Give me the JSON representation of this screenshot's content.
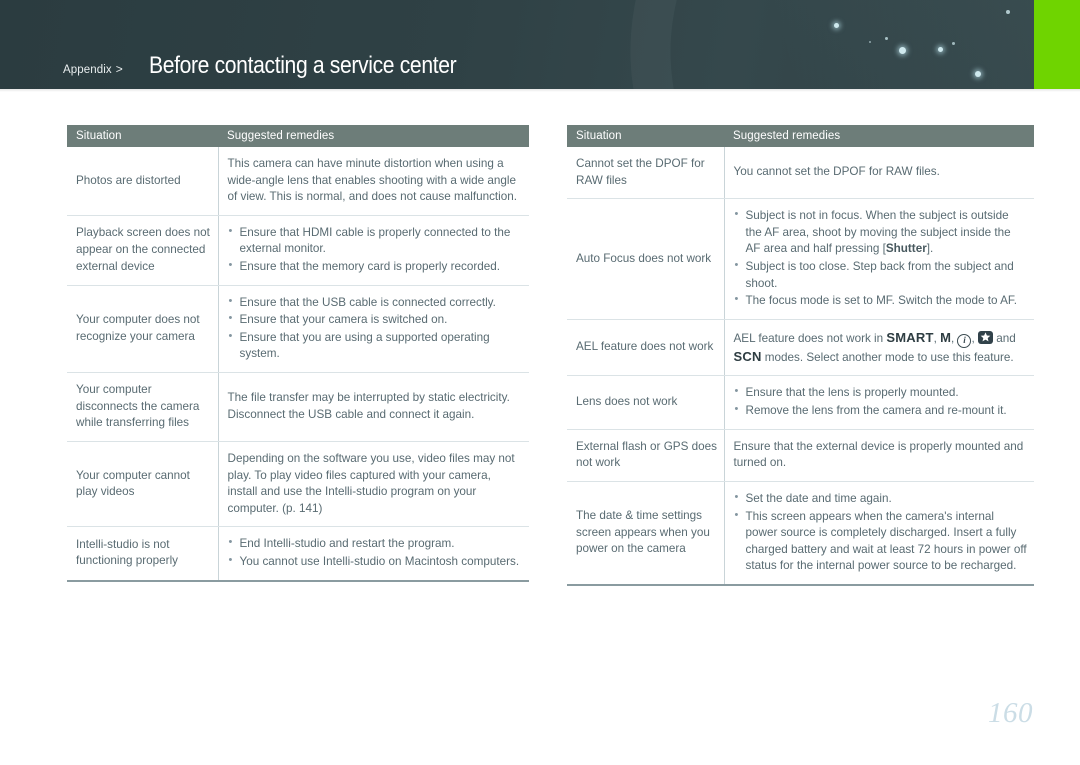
{
  "header": {
    "breadcrumb": "Appendix",
    "breadcrumb_separator": ">",
    "title": "Before contacting a service center",
    "accent_color": "#6fd400",
    "band_color": "#2f4044"
  },
  "tables": {
    "column_headers": {
      "situation": "Situation",
      "remedies": "Suggested remedies"
    },
    "left": [
      {
        "situation": "Photos are distorted",
        "type": "paragraph",
        "text": "This camera can have minute distortion when using a wide-angle lens that enables shooting with a wide angle of view. This is normal, and does not cause malfunction."
      },
      {
        "situation": "Playback screen does not appear on the connected external device",
        "type": "bullets",
        "items": [
          "Ensure that HDMI cable is properly connected to the external monitor.",
          "Ensure that the memory card is properly recorded."
        ]
      },
      {
        "situation": "Your computer does not recognize your camera",
        "type": "bullets",
        "items": [
          "Ensure that the USB cable is connected correctly.",
          "Ensure that your camera is switched on.",
          "Ensure that you are using a supported operating system."
        ]
      },
      {
        "situation": "Your computer disconnects the camera while transferring files",
        "type": "paragraph",
        "text": "The file transfer may be interrupted by static electricity. Disconnect the USB cable and connect it again."
      },
      {
        "situation": "Your computer cannot play videos",
        "type": "paragraph",
        "text": "Depending on the software you use, video files may not play. To play video files captured with your camera, install and use the Intelli-studio program on your computer. (p. 141)"
      },
      {
        "situation": "Intelli-studio is not functioning properly",
        "type": "bullets",
        "items": [
          "End Intelli-studio and restart the program.",
          "You cannot use Intelli-studio on Macintosh computers."
        ]
      }
    ],
    "right": [
      {
        "situation": "Cannot set the DPOF for RAW files",
        "type": "paragraph",
        "text": "You cannot set the DPOF for RAW files."
      },
      {
        "situation": "Auto Focus does not work",
        "type": "bullets-rich",
        "items": [
          {
            "before": "Subject is not in focus. When the subject is outside the AF area, shoot by moving the subject inside the AF area and half pressing [",
            "bold": "Shutter",
            "after": "]."
          },
          {
            "before": "Subject is too close. Step back from the subject and shoot.",
            "bold": "",
            "after": ""
          },
          {
            "before": "The focus mode is set to MF. Switch the mode to AF.",
            "bold": "",
            "after": ""
          }
        ]
      },
      {
        "situation": "AEL feature does not work",
        "type": "modes",
        "text_1": "AEL feature does not work in ",
        "mode_smart": "SMART",
        "sep_1": ", ",
        "mode_m": "M",
        "sep_2": ", ",
        "mode_info": "i",
        "sep_3": ", ",
        "mode_star": "star-badge",
        "text_2": " and ",
        "mode_scn": "SCN",
        "text_3": " modes. Select another mode to use this feature."
      },
      {
        "situation": "Lens does not work",
        "type": "bullets",
        "items": [
          "Ensure that the lens is properly mounted.",
          "Remove the lens from the camera and re-mount it."
        ]
      },
      {
        "situation": "External flash or GPS does not work",
        "type": "paragraph",
        "text": "Ensure that the external device is properly mounted and turned on."
      },
      {
        "situation": "The date & time settings screen appears when you power on the camera",
        "type": "bullets",
        "items": [
          "Set the date and time again.",
          "This screen appears when the camera's internal power source is completely discharged. Insert a fully charged battery and wait at least 72 hours in power off status for the internal power source to be recharged."
        ]
      }
    ]
  },
  "footer": {
    "page_number": "160"
  }
}
